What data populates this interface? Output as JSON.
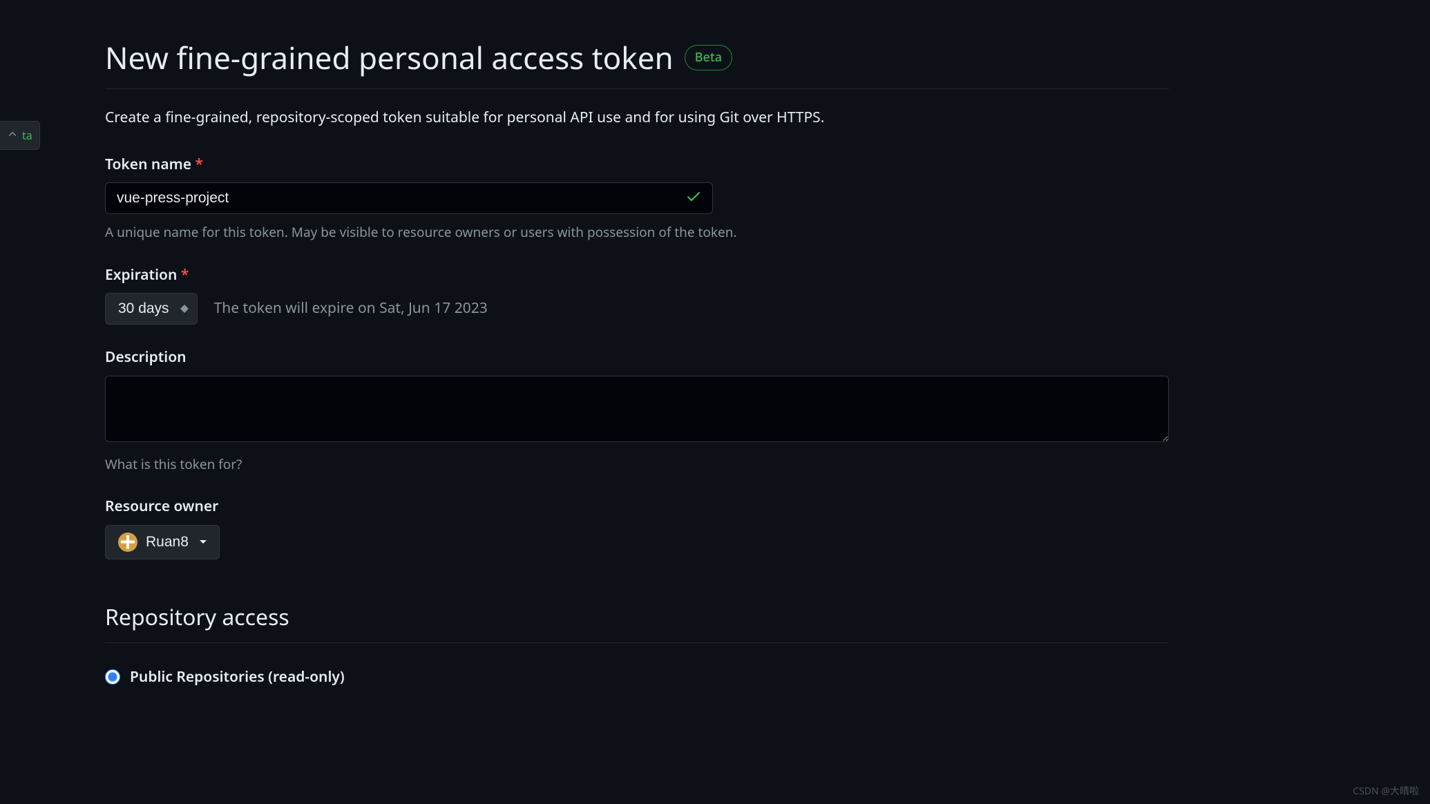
{
  "side_tab": {
    "label": "ta"
  },
  "header": {
    "title": "New fine-grained personal access token",
    "badge": "Beta"
  },
  "intro": "Create a fine-grained, repository-scoped token suitable for personal API use and for using Git over HTTPS.",
  "token_name": {
    "label": "Token name",
    "value": "vue-press-project",
    "help": "A unique name for this token. May be visible to resource owners or users with possession of the token."
  },
  "expiration": {
    "label": "Expiration",
    "selected": "30 days",
    "info": "The token will expire on Sat, Jun 17 2023"
  },
  "description": {
    "label": "Description",
    "value": "",
    "help": "What is this token for?"
  },
  "resource_owner": {
    "label": "Resource owner",
    "selected": "Ruan8"
  },
  "repository_access": {
    "title": "Repository access",
    "options": {
      "public": "Public Repositories (read-only)"
    }
  },
  "watermark": "CSDN @大晴啦"
}
